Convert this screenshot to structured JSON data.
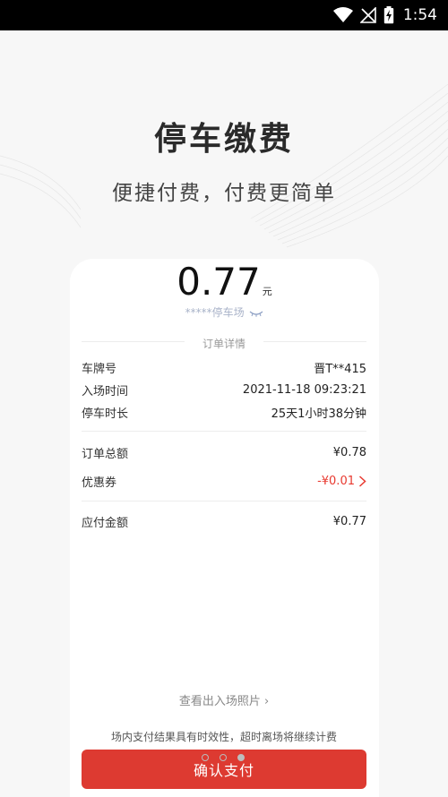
{
  "status_bar": {
    "time": "1:54"
  },
  "hero": {
    "title": "停车缴费",
    "subtitle": "便捷付费，付费更简单"
  },
  "order": {
    "amount": "0.77",
    "amount_unit": "元",
    "parking_name": "*****停车场",
    "section_title": "订单详情",
    "details": [
      {
        "label": "车牌号",
        "value": "晋T**415"
      },
      {
        "label": "入场时间",
        "value": "2021-11-18 09:23:21"
      },
      {
        "label": "停车时长",
        "value": "25天1小时38分钟"
      }
    ],
    "total_label": "订单总额",
    "total_value": "¥0.78",
    "coupon_label": "优惠券",
    "coupon_value": "-¥0.01",
    "payable_label": "应付金额",
    "payable_value": "¥0.77"
  },
  "photo_link": "查看出入场照片 ›",
  "notice": "场内支付结果具有时效性，超时离场将继续计费",
  "pager": {
    "count": 3,
    "active_index": 2
  },
  "pay_button": "确认支付",
  "colors": {
    "accent": "#dd3a31",
    "coupon": "#e8392f",
    "muted": "#a9b3c9"
  },
  "icons": [
    "wifi-icon",
    "no-signal-icon",
    "battery-charging-icon",
    "eye-closed-icon",
    "chevron-right-icon"
  ]
}
